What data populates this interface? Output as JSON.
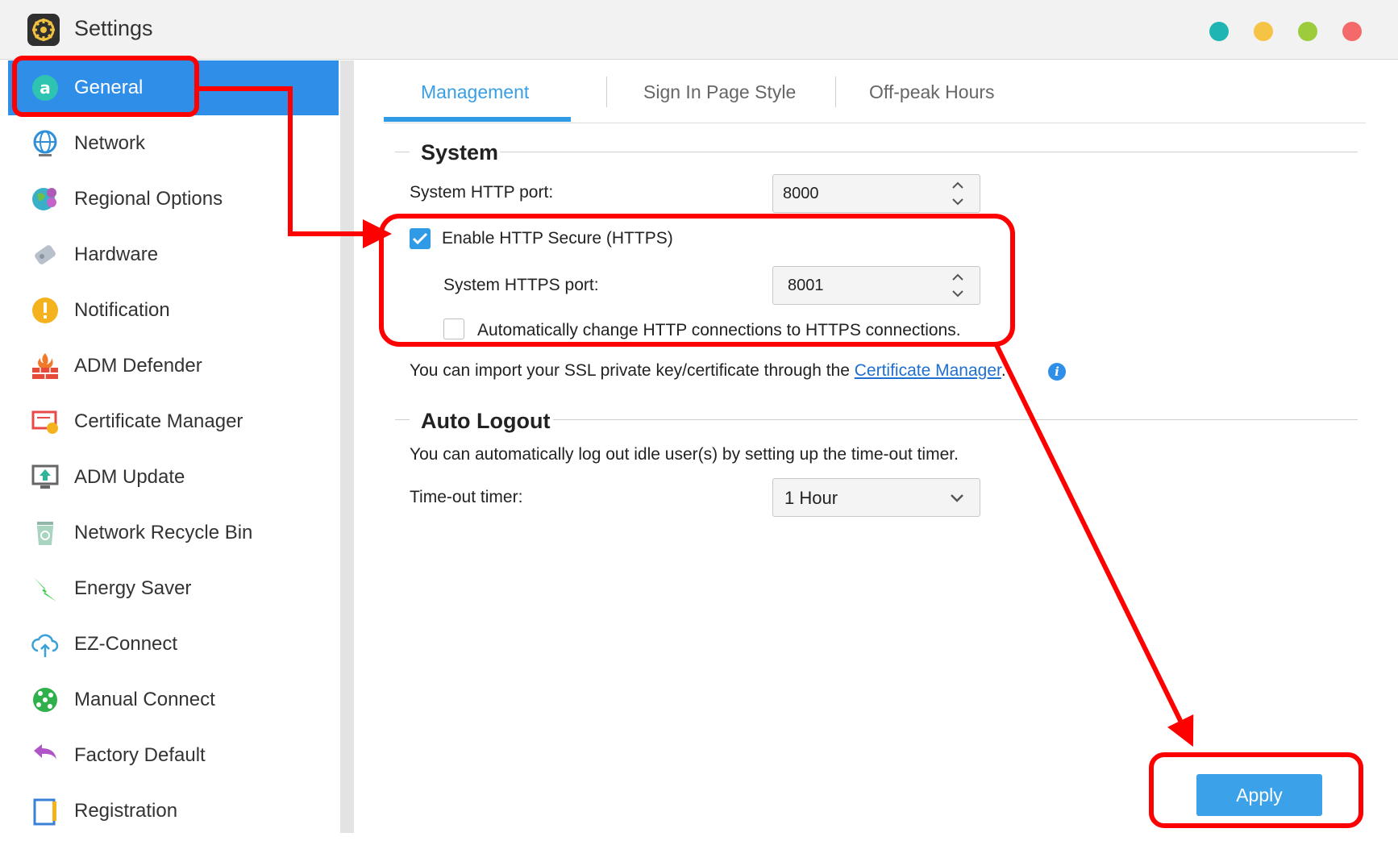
{
  "window": {
    "title": "Settings",
    "controls": [
      {
        "name": "teal",
        "color": "#1fb5b2"
      },
      {
        "name": "yellow",
        "color": "#f6c444"
      },
      {
        "name": "green",
        "color": "#9ccc3c"
      },
      {
        "name": "red",
        "color": "#f46a6a"
      }
    ]
  },
  "sidebar": {
    "items": [
      {
        "label": "General",
        "icon": "general-icon",
        "active": true
      },
      {
        "label": "Network",
        "icon": "globe-icon"
      },
      {
        "label": "Regional Options",
        "icon": "regional-globe-pin-icon"
      },
      {
        "label": "Hardware",
        "icon": "hardware-icon"
      },
      {
        "label": "Notification",
        "icon": "alert-icon"
      },
      {
        "label": "ADM Defender",
        "icon": "firewall-icon"
      },
      {
        "label": "Certificate Manager",
        "icon": "certificate-icon"
      },
      {
        "label": "ADM Update",
        "icon": "update-icon"
      },
      {
        "label": "Network Recycle Bin",
        "icon": "recycle-bin-icon"
      },
      {
        "label": "Energy Saver",
        "icon": "lightning-icon"
      },
      {
        "label": "EZ-Connect",
        "icon": "cloud-upload-icon"
      },
      {
        "label": "Manual Connect",
        "icon": "network-sphere-icon"
      },
      {
        "label": "Factory Default",
        "icon": "undo-arrow-icon"
      },
      {
        "label": "Registration",
        "icon": "registration-icon"
      }
    ]
  },
  "tabs": [
    {
      "label": "Management",
      "active": true
    },
    {
      "label": "Sign In Page Style"
    },
    {
      "label": "Off-peak Hours"
    }
  ],
  "system": {
    "title": "System",
    "http_port_label": "System HTTP port:",
    "http_port_value": "8000",
    "https_enable_label": "Enable HTTP Secure (HTTPS)",
    "https_enabled": true,
    "https_port_label": "System HTTPS port:",
    "https_port_value": "8001",
    "auto_redirect_label": "Automatically change HTTP connections to HTTPS connections.",
    "auto_redirect_enabled": false,
    "ssl_note_prefix": "You can import your SSL private key/certificate through the ",
    "ssl_note_link": "Certificate Manager",
    "ssl_note_suffix": "."
  },
  "auto_logout": {
    "title": "Auto Logout",
    "description": "You can automatically log out idle user(s) by setting up the time-out timer.",
    "timer_label": "Time-out timer:",
    "timer_value": "1 Hour"
  },
  "footer": {
    "apply_label": "Apply"
  },
  "annotation": {
    "color": "#ff0000"
  }
}
